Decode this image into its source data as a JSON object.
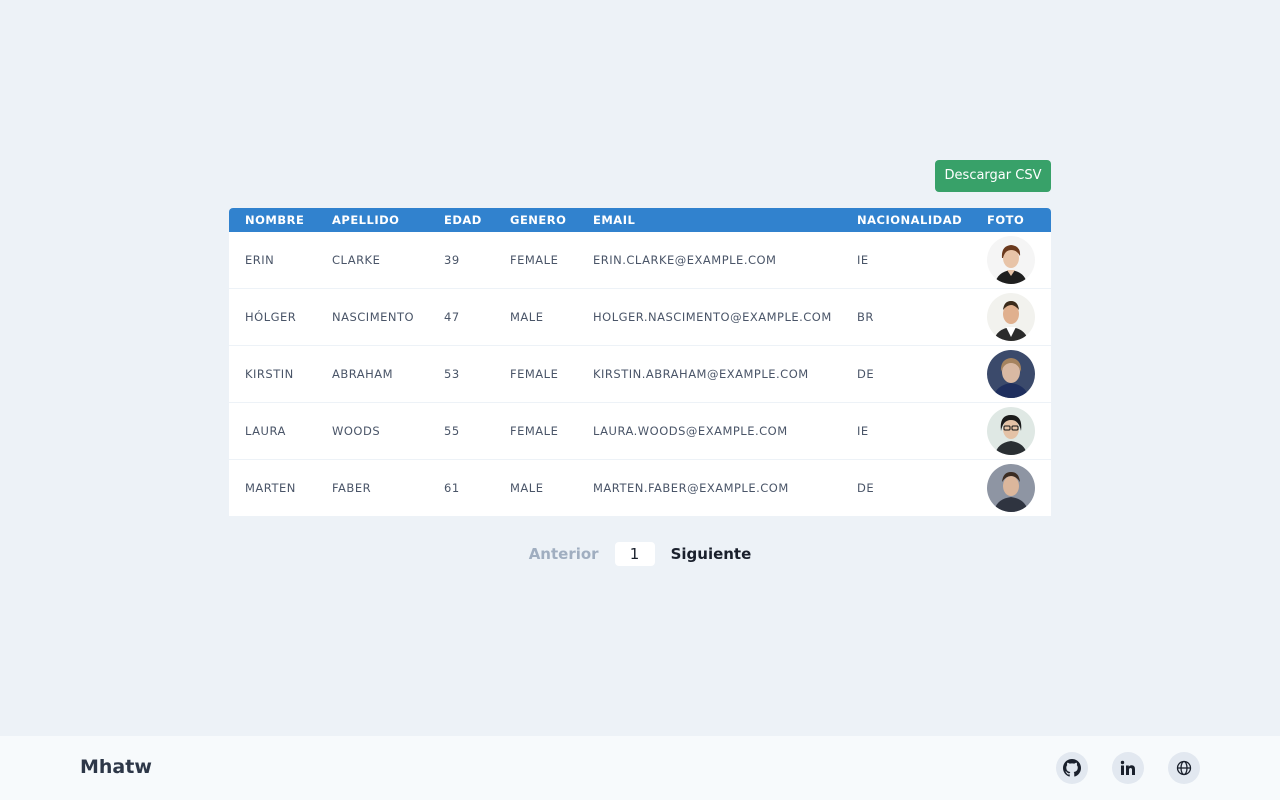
{
  "toolbar": {
    "download_csv_label": "Descargar CSV"
  },
  "table": {
    "headers": [
      "NOMBRE",
      "APELLIDO",
      "EDAD",
      "GENERO",
      "EMAIL",
      "NACIONALIDAD",
      "FOTO"
    ],
    "rows": [
      {
        "nombre": "ERIN",
        "apellido": "CLARKE",
        "edad": "39",
        "genero": "FEMALE",
        "email": "ERIN.CLARKE@EXAMPLE.COM",
        "nacionalidad": "IE",
        "foto": "avatar-erin"
      },
      {
        "nombre": "HÓLGER",
        "apellido": "NASCIMENTO",
        "edad": "47",
        "genero": "MALE",
        "email": "HOLGER.NASCIMENTO@EXAMPLE.COM",
        "nacionalidad": "BR",
        "foto": "avatar-holger"
      },
      {
        "nombre": "KIRSTIN",
        "apellido": "ABRAHAM",
        "edad": "53",
        "genero": "FEMALE",
        "email": "KIRSTIN.ABRAHAM@EXAMPLE.COM",
        "nacionalidad": "DE",
        "foto": "avatar-kirstin"
      },
      {
        "nombre": "LAURA",
        "apellido": "WOODS",
        "edad": "55",
        "genero": "FEMALE",
        "email": "LAURA.WOODS@EXAMPLE.COM",
        "nacionalidad": "IE",
        "foto": "avatar-laura"
      },
      {
        "nombre": "MARTEN",
        "apellido": "FABER",
        "edad": "61",
        "genero": "MALE",
        "email": "MARTEN.FABER@EXAMPLE.COM",
        "nacionalidad": "DE",
        "foto": "avatar-marten"
      }
    ]
  },
  "pagination": {
    "prev_label": "Anterior",
    "current_page": "1",
    "next_label": "Siguiente"
  },
  "footer": {
    "brand": "Mhatw",
    "links": [
      {
        "icon": "github-icon"
      },
      {
        "icon": "linkedin-icon"
      },
      {
        "icon": "globe-icon"
      }
    ]
  },
  "colors": {
    "background": "#edf2f7",
    "header": "#3182ce",
    "button": "#38a169",
    "footer": "#f7fafc"
  }
}
